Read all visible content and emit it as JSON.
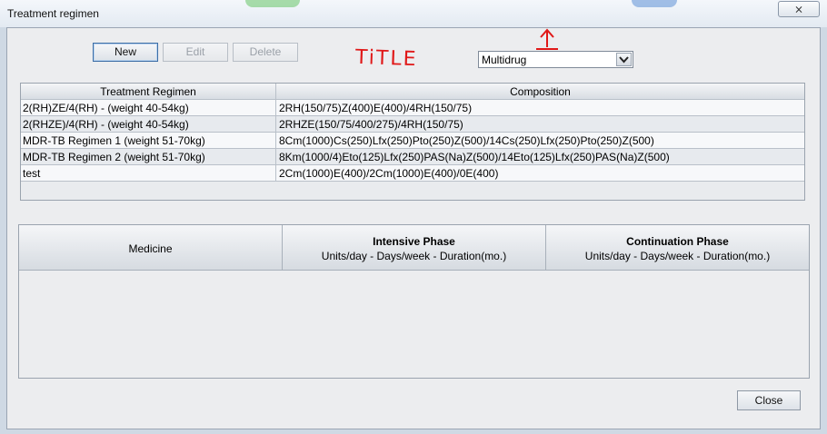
{
  "window": {
    "title": "Treatment regimen",
    "close_glyph": "⨯"
  },
  "toolbar": {
    "new_label": "New",
    "edit_label": "Edit",
    "delete_label": "Delete"
  },
  "annotation": {
    "text": "TiTLE"
  },
  "filter": {
    "selected": "Multidrug"
  },
  "regimens": {
    "headers": [
      "Treatment Regimen",
      "Composition"
    ],
    "rows": [
      {
        "name": "2(RH)ZE/4(RH) - (weight 40-54kg)",
        "composition": "2RH(150/75)Z(400)E(400)/4RH(150/75)"
      },
      {
        "name": "2(RHZE)/4(RH) - (weight 40-54kg)",
        "composition": "2RHZE(150/75/400/275)/4RH(150/75)"
      },
      {
        "name": "MDR-TB Regimen 1 (weight 51-70kg)",
        "composition": "8Cm(1000)Cs(250)Lfx(250)Pto(250)Z(500)/14Cs(250)Lfx(250)Pto(250)Z(500)"
      },
      {
        "name": "MDR-TB Regimen 2 (weight 51-70kg)",
        "composition": "8Km(1000/4)Eto(125)Lfx(250)PAS(Na)Z(500)/14Eto(125)Lfx(250)PAS(Na)Z(500)"
      },
      {
        "name": "test",
        "composition": "2Cm(1000)E(400)/2Cm(1000)E(400)/0E(400)"
      }
    ]
  },
  "medicines": {
    "col_medicine": "Medicine",
    "col_intensive": "Intensive Phase",
    "col_intensive_sub": "Units/day - Days/week - Duration(mo.)",
    "col_continuation": "Continuation Phase",
    "col_continuation_sub": "Units/day - Days/week - Duration(mo.)"
  },
  "footer": {
    "close_label": "Close"
  },
  "colors": {
    "annotation": "#e01818",
    "accent": "#3d6ea6"
  }
}
